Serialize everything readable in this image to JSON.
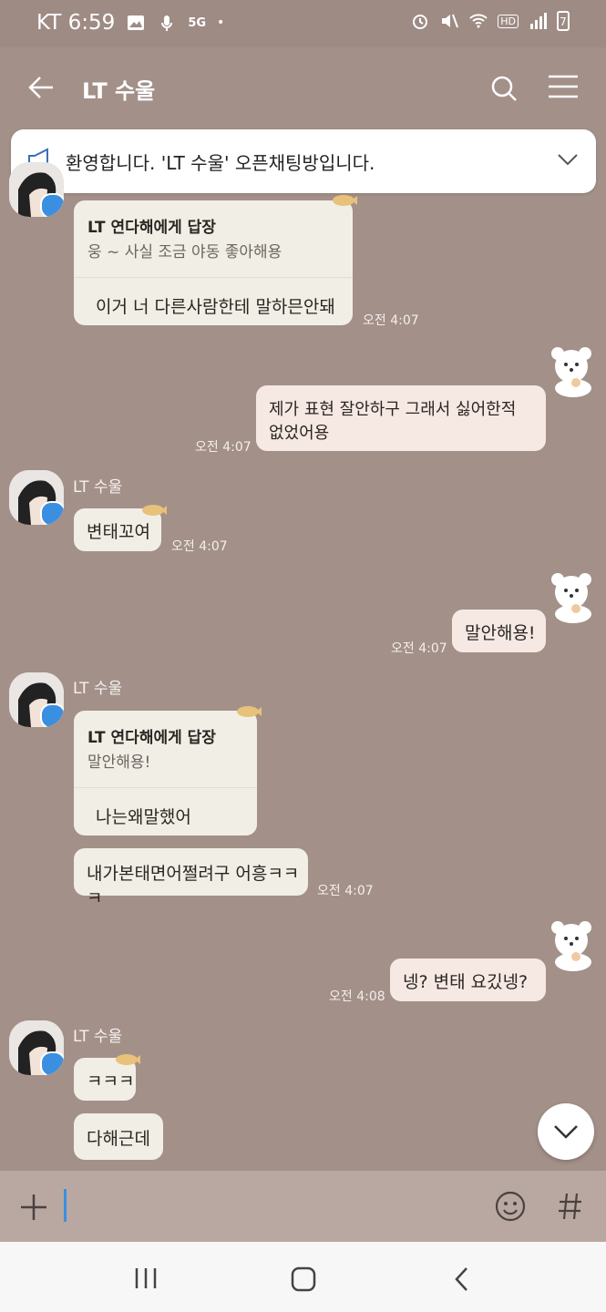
{
  "status_bar": {
    "carrier_time": "KT 6:59",
    "network": "5G",
    "hd": "HD",
    "battery": "7"
  },
  "header": {
    "title": "LT 수울"
  },
  "notice": {
    "text": "환영합니다. 'LT 수울' 오픈채팅방입니다."
  },
  "messages": [
    {
      "sender": "",
      "reply_title": "LT 연다해에게 답장",
      "reply_quote": "웅 ~ 사실 조금 야동 좋아해용",
      "text": "이거 너 다른사람한테 말하믄안돼",
      "time": "오전 4:07"
    },
    {
      "mine": true,
      "text_line1": "제가 표현 잘안하구 그래서  싫어한적",
      "text_line2": "없었어용",
      "time": "오전 4:07"
    },
    {
      "sender": "LT 수울",
      "text": "변태꼬여",
      "time": "오전 4:07"
    },
    {
      "mine": true,
      "text": "말안해용!",
      "time": "오전 4:07"
    },
    {
      "sender": "LT 수울",
      "reply_title": "LT 연다해에게 답장",
      "reply_quote": "말안해용!",
      "text": "나는왜말했어"
    },
    {
      "text": "내가본태면어쩔려구 어흥ㅋㅋㅋ",
      "time": "오전 4:07"
    },
    {
      "mine": true,
      "text": "넹?  변태 요깄넹?",
      "time": "오전 4:08"
    },
    {
      "sender": "LT 수울",
      "text": "ㅋㅋㅋ"
    },
    {
      "text": "다해근데"
    }
  ],
  "colors": {
    "background": "#a39089",
    "bubble": "#f1eee6",
    "my_bubble": "#f6e9e4",
    "accent": "#3b8fe0"
  }
}
